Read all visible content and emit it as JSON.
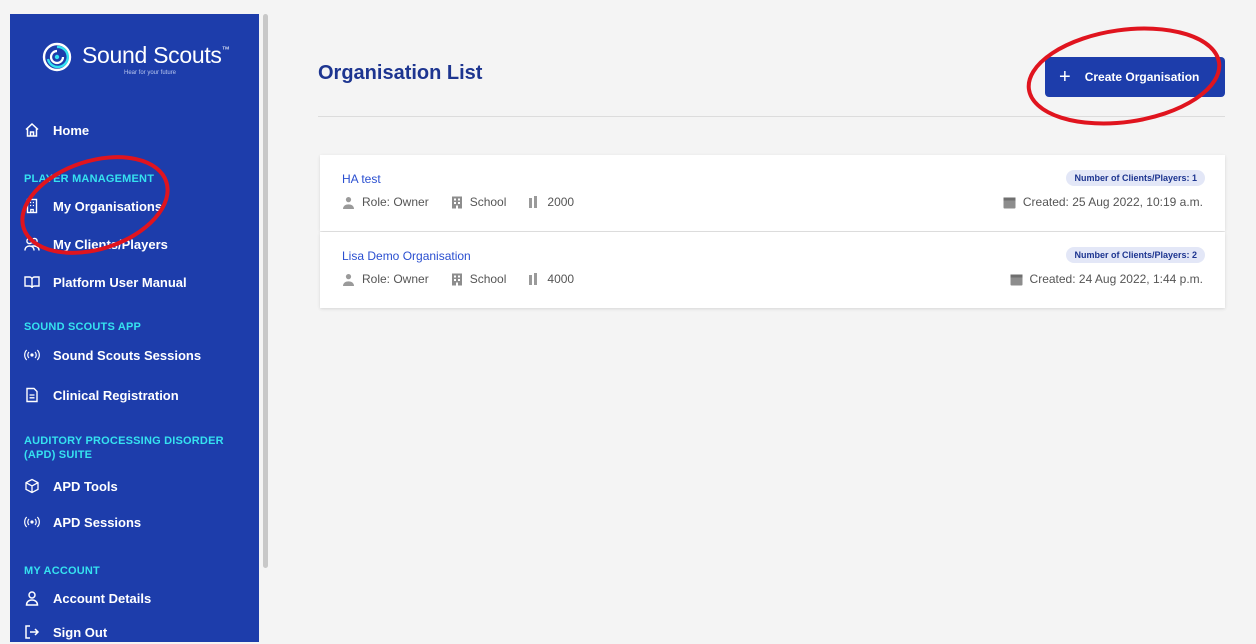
{
  "brand": {
    "name": "Sound Scouts",
    "trademark": "™",
    "tagline": "Hear for your future"
  },
  "nav": {
    "home": "Home",
    "player_management": {
      "heading": "PLAYER MANAGEMENT",
      "my_organisations": "My Organisations",
      "my_clients_players": "My Clients/Players",
      "platform_user_manual": "Platform User Manual"
    },
    "sound_scouts_app": {
      "heading": "SOUND SCOUTS APP",
      "sessions": "Sound Scouts Sessions",
      "clinical_registration": "Clinical Registration"
    },
    "apd_suite": {
      "heading_line1": "AUDITORY PROCESSING DISORDER",
      "heading_line2": "(APD) SUITE",
      "apd_tools": "APD Tools",
      "apd_sessions": "APD Sessions"
    },
    "my_account": {
      "heading": "MY ACCOUNT",
      "account_details": "Account Details",
      "sign_out": "Sign Out"
    }
  },
  "main": {
    "title": "Organisation List",
    "create_button": "Create Organisation",
    "organisations": [
      {
        "name": "HA test",
        "role": "Role: Owner",
        "type": "School",
        "postcode": "2000",
        "clients_badge": "Number of Clients/Players: 1",
        "created": "Created: 25 Aug 2022, 10:19 a.m."
      },
      {
        "name": "Lisa Demo Organisation",
        "role": "Role: Owner",
        "type": "School",
        "postcode": "4000",
        "clients_badge": "Number of Clients/Players: 2",
        "created": "Created: 24 Aug 2022, 1:44 p.m."
      }
    ]
  },
  "colors": {
    "sidebar_bg": "#1d3dab",
    "section_heading": "#35e2f0",
    "title": "#1d3590",
    "link": "#2a4fd0",
    "annotation": "#e0141e"
  }
}
